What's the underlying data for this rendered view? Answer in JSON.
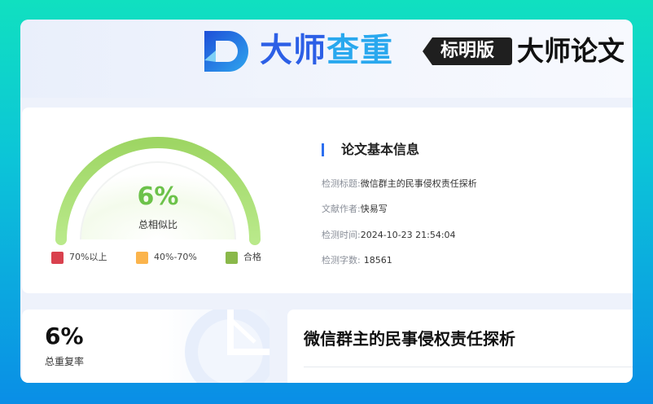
{
  "header": {
    "brand_part1": "大师",
    "brand_part2": "查重",
    "edition": "标明版",
    "title": "大师论文"
  },
  "similarity": {
    "percent": "6%",
    "value": 0.06,
    "label": "总相似比",
    "legend": [
      {
        "label": "70%以上",
        "color": "#d9414e"
      },
      {
        "label": "40%-70%",
        "color": "#fbb44c"
      },
      {
        "label": "合格",
        "color": "#8ab84a"
      }
    ]
  },
  "info": {
    "title": "论文基本信息",
    "rows": [
      {
        "key": "检测标题:",
        "value": "微信群主的民事侵权责任探析"
      },
      {
        "key": "文献作者:",
        "value": "快易写"
      },
      {
        "key": "检测时间:",
        "value": "2024-10-23 21:54:04"
      },
      {
        "key": "检测字数:",
        "value": "18561"
      }
    ]
  },
  "rate": {
    "percent": "6%",
    "label": "总重复率"
  },
  "document": {
    "title": "微信群主的民事侵权责任探析"
  },
  "colors": {
    "accent_blue": "#2c5fe6",
    "accent_cyan": "#29a8ee",
    "gauge_green": "#6cc24a"
  }
}
